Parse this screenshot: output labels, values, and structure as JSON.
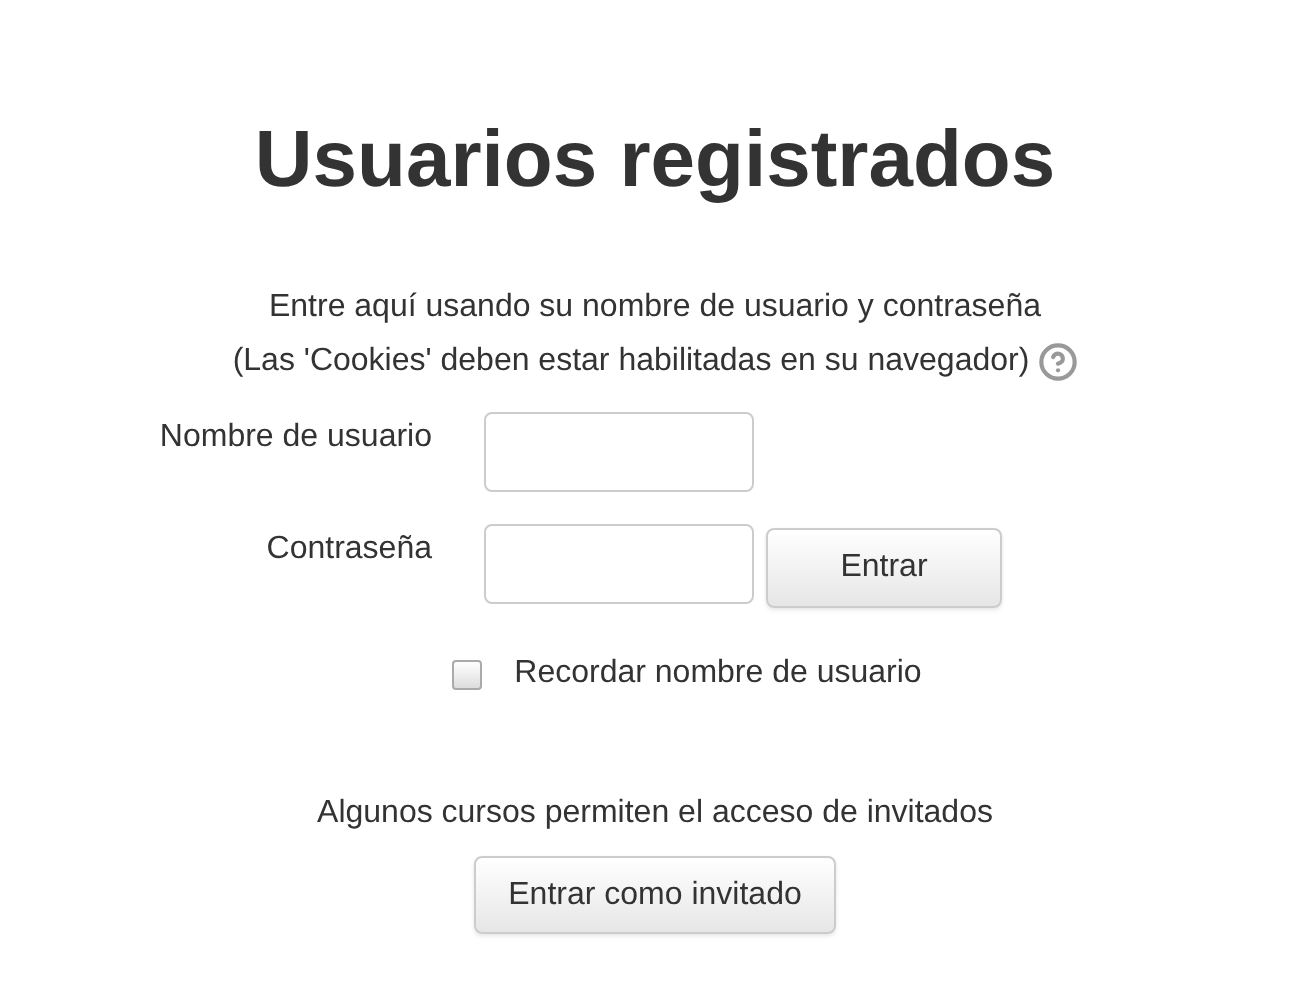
{
  "title": "Usuarios registrados",
  "intro": [
    "Entre aquí usando su nombre de usuario y contraseña",
    "(Las 'Cookies' deben estar habilitadas en su navegador)"
  ],
  "fields": [
    {
      "label": "Nombre de usuario"
    },
    {
      "label": "Contraseña"
    }
  ],
  "login_button": "Entrar",
  "remember": {
    "label": "Recordar nombre de usuario",
    "checked": false
  },
  "guest": {
    "text": "Algunos cursos permiten el acceso de invitados",
    "button": "Entrar como invitado"
  }
}
